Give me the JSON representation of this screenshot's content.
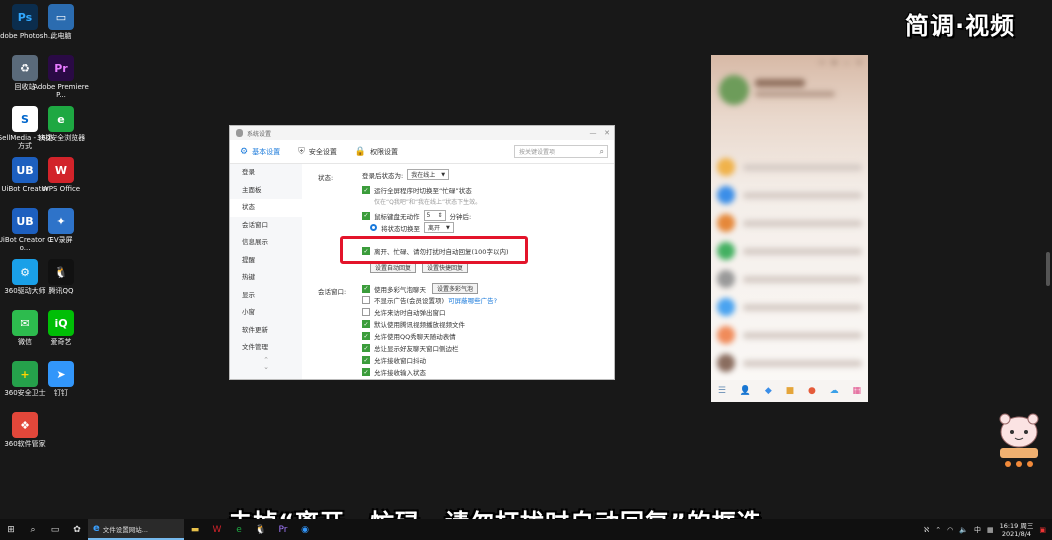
{
  "watermark": "简调·视频",
  "desktop_icons": [
    {
      "label": "Adobe Photosh...",
      "glyph": "Ps",
      "color": "#0b2d4d",
      "fg": "#31a8ff"
    },
    {
      "label": "此电脑",
      "glyph": "▭",
      "color": "#2b6cb0",
      "fg": "#ffffff"
    },
    {
      "label": "回收站",
      "glyph": "♻",
      "color": "#5a6a7a",
      "fg": "#ffffff"
    },
    {
      "label": "Adobe Premiere P...",
      "glyph": "Pr",
      "color": "#2a0a45",
      "fg": "#e77bff"
    },
    {
      "label": "SellMedia - 快捷方式",
      "glyph": "S",
      "color": "#ffffff",
      "fg": "#0066cc"
    },
    {
      "label": "360安全浏览器",
      "glyph": "e",
      "color": "#1ea842",
      "fg": "#ffffff"
    },
    {
      "label": "UiBot Creator",
      "glyph": "UB",
      "color": "#1d5fbf",
      "fg": "#ffffff"
    },
    {
      "label": "WPS Office",
      "glyph": "W",
      "color": "#d2232a",
      "fg": "#ffffff"
    },
    {
      "label": "UiBot Creator Co...",
      "glyph": "UB",
      "color": "#1d5fbf",
      "fg": "#ffffff"
    },
    {
      "label": "EV录屏",
      "glyph": "✦",
      "color": "#2e73c9",
      "fg": "#ffffff"
    },
    {
      "label": "360驱动大师",
      "glyph": "⚙",
      "color": "#1aa0e8",
      "fg": "#ffffff"
    },
    {
      "label": "腾讯QQ",
      "glyph": "🐧",
      "color": "#111111",
      "fg": "#ffffff"
    },
    {
      "label": "微信",
      "glyph": "✉",
      "color": "#2dbb4e",
      "fg": "#ffffff"
    },
    {
      "label": "爱奇艺",
      "glyph": "iQ",
      "color": "#00be06",
      "fg": "#ffffff"
    },
    {
      "label": "360安全卫士",
      "glyph": "+",
      "color": "#25a14b",
      "fg": "#ffd400"
    },
    {
      "label": "钉钉",
      "glyph": "➤",
      "color": "#3296fa",
      "fg": "#ffffff"
    },
    {
      "label": "360软件管家",
      "glyph": "❖",
      "color": "#e2473a",
      "fg": "#ffffff"
    }
  ],
  "settings": {
    "title": "系统设置",
    "tabs": [
      {
        "label": "基本设置",
        "icon": "gear-icon",
        "glyph": "⚙"
      },
      {
        "label": "安全设置",
        "icon": "shield-icon",
        "glyph": "⛨"
      },
      {
        "label": "权限设置",
        "icon": "lock-icon",
        "glyph": "🔒"
      }
    ],
    "search_placeholder": "按关键设置项",
    "sidebar": [
      "登录",
      "主面板",
      "状态",
      "会话窗口",
      "信息展示",
      "提醒",
      "热键",
      "显示",
      "小窗",
      "软件更新",
      "文件管理"
    ],
    "sidebar_active": 2,
    "status": {
      "label": "状态:",
      "login_prefix": "登录后状态为:",
      "login_value": "我在线上",
      "fullscreen": "运行全屏程序时切换至“忙碌”状态",
      "fullscreen_note": "仅在“Q我吧”和“我在线上”状态下生效。",
      "idle_prefix": "鼠标键盘无动作",
      "idle_minutes": "5",
      "idle_suffix": "分钟后:",
      "switch_prefix": "将状态切换至",
      "switch_value": "离开",
      "auto_reply": "离开、忙碌、请勿打扰时自动回复(100字以内)",
      "btn_a": "设置自动回复",
      "btn_b": "设置快捷回复"
    },
    "chat": {
      "label": "会话窗口:",
      "items": [
        {
          "text": "使用多彩气泡聊天",
          "on": true,
          "button": "设置多彩气泡"
        },
        {
          "text": "不显示广告(会员设置项)",
          "on": false,
          "link": "可屏蔽哪些广告?"
        },
        {
          "text": "允许来访时自动弹出窗口",
          "on": false
        },
        {
          "text": "默认使用腾讯视频播放视频文件",
          "on": true
        },
        {
          "text": "允许使用QQ秀聊天随动表情",
          "on": true
        },
        {
          "text": "总让显示好友聊天窗口侧边栏",
          "on": true
        },
        {
          "text": "允许接收窗口抖动",
          "on": true
        },
        {
          "text": "允许接收输入状态",
          "on": true
        }
      ]
    }
  },
  "subtitle": "去掉“离开、忙碌、请勿打扰时自动回复”的框选",
  "taskbar": {
    "app_label": "文件设置网站...",
    "clock_time": "16:19 周三",
    "clock_date": "2021/8/4",
    "ime": "中"
  }
}
